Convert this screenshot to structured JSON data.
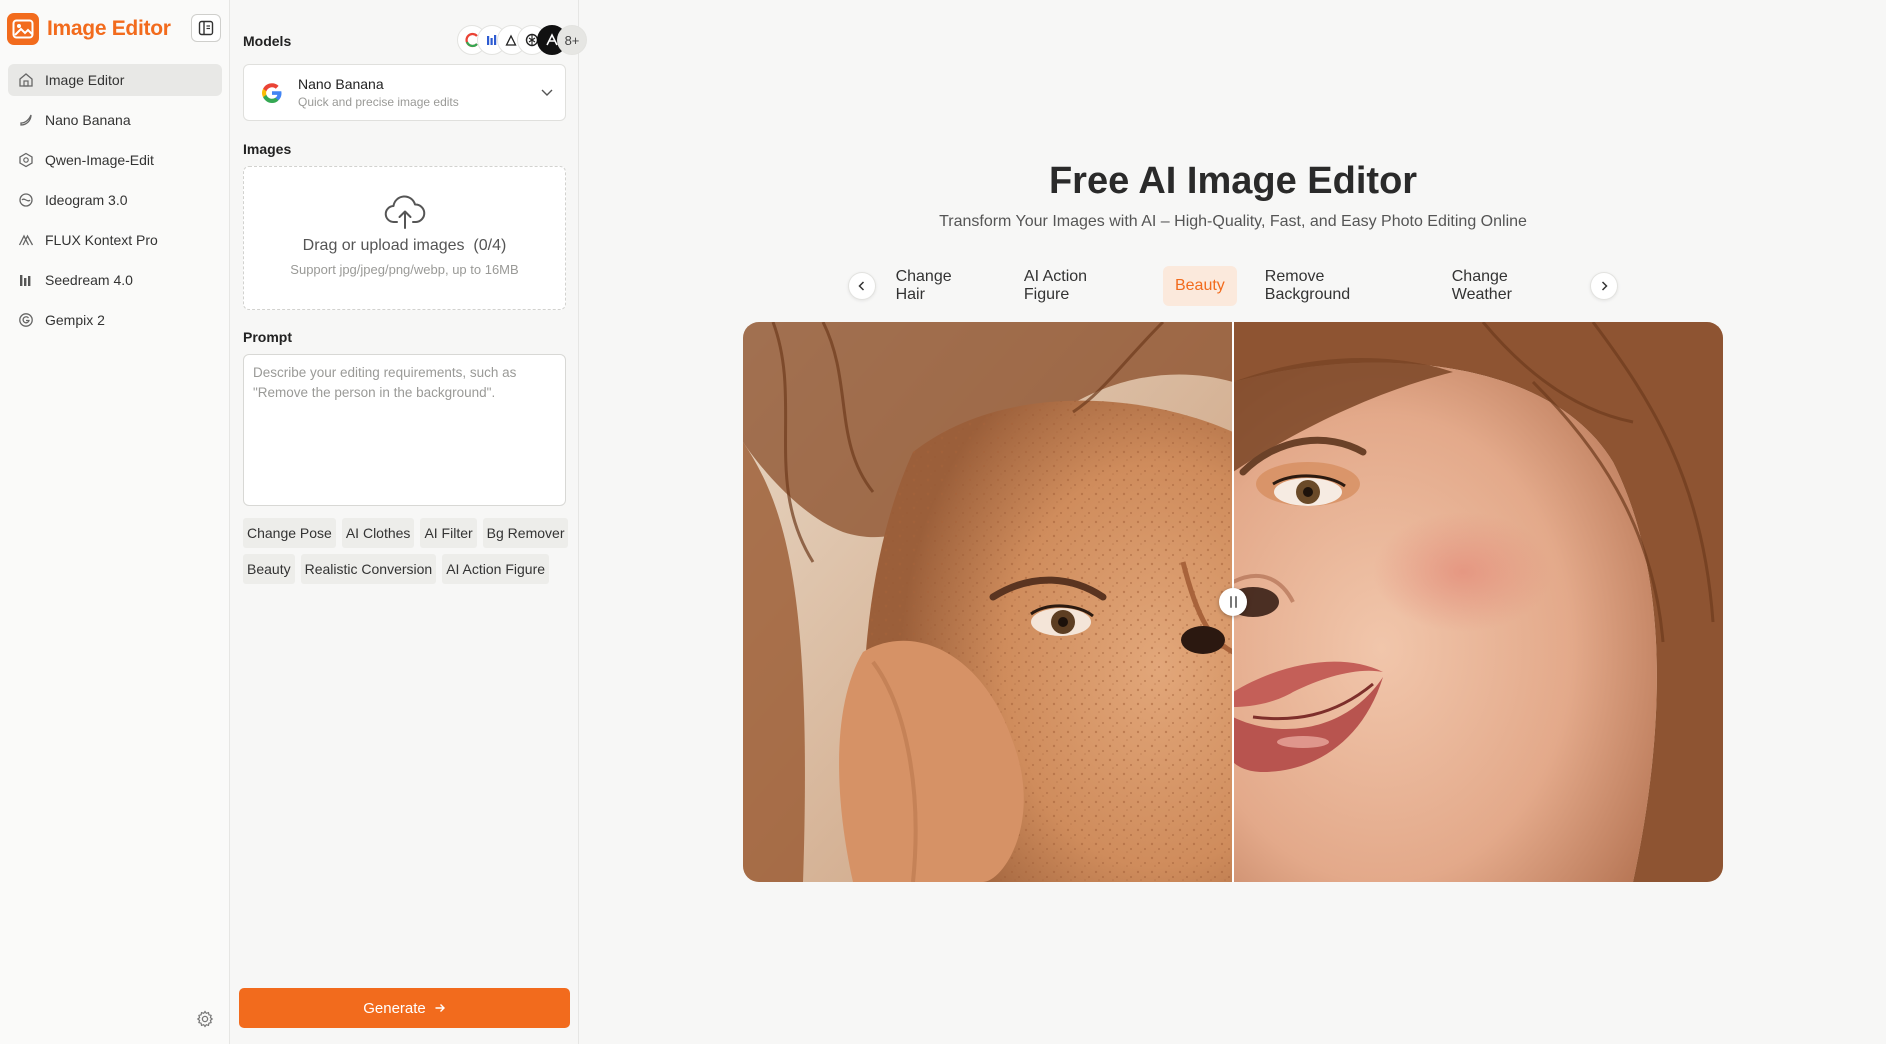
{
  "brand": {
    "title": "Image Editor",
    "color": "#f26b1d"
  },
  "nav": {
    "items": [
      {
        "label": "Image Editor",
        "icon": "home-icon",
        "active": true
      },
      {
        "label": "Nano Banana",
        "icon": "banana-icon"
      },
      {
        "label": "Qwen-Image-Edit",
        "icon": "qwen-icon"
      },
      {
        "label": "Ideogram 3.0",
        "icon": "ideogram-icon"
      },
      {
        "label": "FLUX Kontext Pro",
        "icon": "flux-icon"
      },
      {
        "label": "Seedream 4.0",
        "icon": "seedream-icon"
      },
      {
        "label": "Gempix 2",
        "icon": "gempix-icon"
      }
    ]
  },
  "panel": {
    "models_label": "Models",
    "models_more": "8+",
    "model": {
      "name": "Nano Banana",
      "desc": "Quick and precise image edits",
      "icon": "google-icon"
    },
    "images_label": "Images",
    "upload": {
      "main": "Drag or upload images",
      "count": "(0/4)",
      "sub": "Support jpg/jpeg/png/webp, up to 16MB"
    },
    "prompt_label": "Prompt",
    "prompt_placeholder": "Describe your editing requirements, such as \"Remove the person in the background\".",
    "chips": [
      "Change Pose",
      "AI Clothes",
      "AI Filter",
      "Bg Remover",
      "Beauty",
      "Realistic Conversion",
      "AI Action Figure"
    ],
    "generate_label": "Generate"
  },
  "main": {
    "title": "Free AI Image Editor",
    "subtitle": "Transform Your Images with AI – High-Quality, Fast, and Easy Photo Editing Online",
    "tabs": [
      {
        "label": "Change Hair"
      },
      {
        "label": "AI Action Figure"
      },
      {
        "label": "Beauty",
        "active": true
      },
      {
        "label": "Remove Background"
      },
      {
        "label": "Change Weather"
      }
    ],
    "compare_position": 0.5
  },
  "colors": {
    "accent": "#f26b1d",
    "accent_soft": "#fbe9dc"
  }
}
